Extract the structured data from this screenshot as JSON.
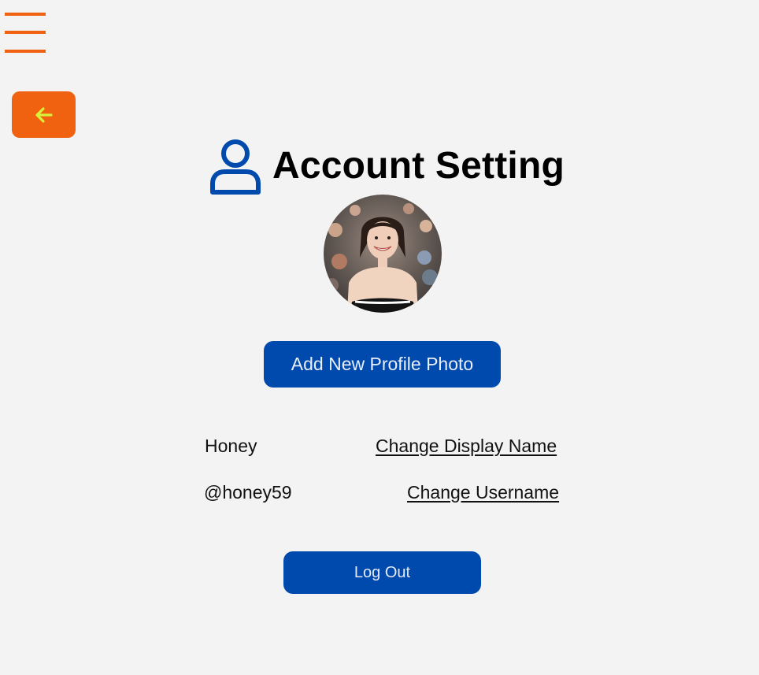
{
  "navigation": {
    "menu_icon": "hamburger-menu-icon",
    "back_icon": "arrow-left-icon"
  },
  "header": {
    "icon": "user-icon",
    "title": "Account Setting"
  },
  "profile": {
    "avatar_icon": "profile-photo",
    "add_photo_label": "Add New Profile Photo",
    "display_name": "Honey",
    "change_display_name_label": "Change Display Name",
    "username": "@honey59",
    "change_username_label": "Change Username"
  },
  "actions": {
    "logout_label": "Log Out"
  },
  "colors": {
    "accent_orange": "#f0620f",
    "primary_blue": "#004aad",
    "background": "#f3f3f3",
    "back_arrow": "#d8f23a"
  }
}
